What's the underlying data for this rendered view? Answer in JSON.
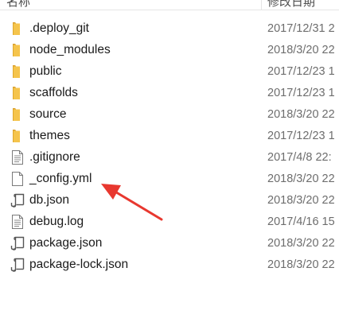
{
  "header": {
    "name_label": "名称",
    "date_label": "修改日期"
  },
  "files": [
    {
      "name": ".deploy_git",
      "date": "2017/12/31 2",
      "icon": "folder-icon"
    },
    {
      "name": "node_modules",
      "date": "2018/3/20 22",
      "icon": "folder-icon"
    },
    {
      "name": "public",
      "date": "2017/12/23 1",
      "icon": "folder-icon"
    },
    {
      "name": "scaffolds",
      "date": "2017/12/23 1",
      "icon": "folder-icon"
    },
    {
      "name": "source",
      "date": "2018/3/20 22",
      "icon": "folder-icon"
    },
    {
      "name": "themes",
      "date": "2017/12/23 1",
      "icon": "folder-icon"
    },
    {
      "name": ".gitignore",
      "date": "2017/4/8 22:",
      "icon": "text-file-icon"
    },
    {
      "name": "_config.yml",
      "date": "2018/3/20 22",
      "icon": "blank-file-icon"
    },
    {
      "name": "db.json",
      "date": "2018/3/20 22",
      "icon": "script-file-icon"
    },
    {
      "name": "debug.log",
      "date": "2017/4/16 15",
      "icon": "text-file-icon"
    },
    {
      "name": "package.json",
      "date": "2018/3/20 22",
      "icon": "script-file-icon"
    },
    {
      "name": "package-lock.json",
      "date": "2018/3/20 22",
      "icon": "script-file-icon"
    }
  ],
  "colors": {
    "folder": "#f5c44c",
    "annotation_arrow": "#e8382f"
  }
}
